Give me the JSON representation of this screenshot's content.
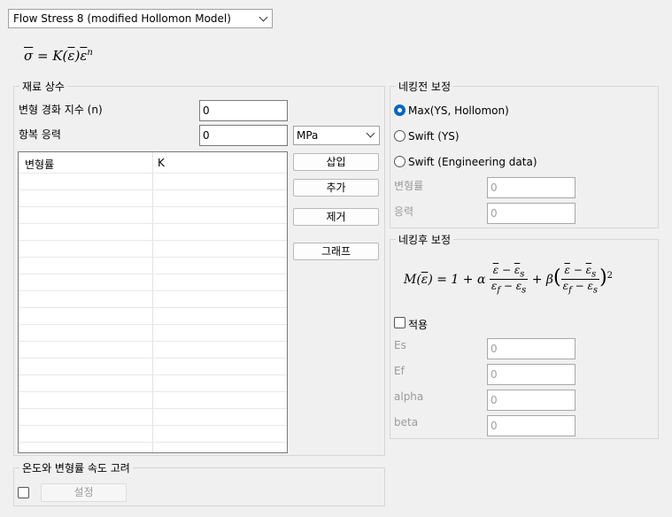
{
  "model_select": {
    "value": "Flow Stress 8 (modified Hollomon Model)"
  },
  "formula_main": "σ̄ = K(ε̄)ε̄ⁿ",
  "material": {
    "title": "재료 상수",
    "n_label": "변형 경화 지수 (n)",
    "n_value": "0",
    "yield_label": "항복 응력",
    "yield_value": "0",
    "unit": "MPa",
    "table_headers": [
      "변형률",
      "K"
    ],
    "buttons": {
      "insert": "삽입",
      "add": "추가",
      "remove": "제거",
      "graph": "그래프"
    }
  },
  "pre_necking": {
    "title": "네킹전 보정",
    "options": [
      "Max(YS, Hollomon)",
      "Swift (YS)",
      "Swift (Engineering data)"
    ],
    "selected": 0,
    "strain_label": "변형률",
    "strain_value": "0",
    "stress_label": "응력",
    "stress_value": "0"
  },
  "post_necking": {
    "title": "네킹후 보정",
    "apply_label": "적용",
    "apply_checked": false,
    "fields": [
      {
        "label": "Es",
        "value": "0"
      },
      {
        "label": "Ef",
        "value": "0"
      },
      {
        "label": "alpha",
        "value": "0"
      },
      {
        "label": "beta",
        "value": "0"
      }
    ]
  },
  "temp_rate": {
    "title": "온도와 변형률 속도 고려",
    "checked": false,
    "settings_label": "설정"
  }
}
